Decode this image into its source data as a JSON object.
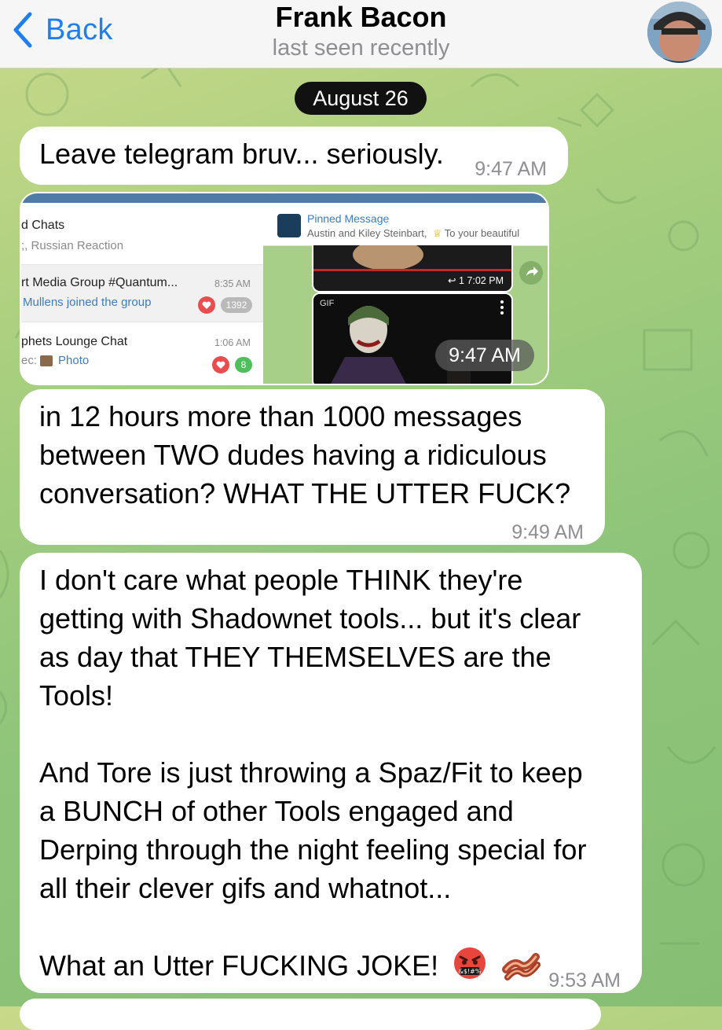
{
  "header": {
    "back_label": "Back",
    "title": "Frank Bacon",
    "status": "last seen recently"
  },
  "date_pill": "August 26",
  "messages": [
    {
      "text": "Leave telegram bruv... seriously.",
      "time": "9:47 AM"
    },
    {
      "type": "image",
      "time": "9:47 AM",
      "screenshot": {
        "list_header": {
          "name": "d Chats",
          "sub": ";, Russian Reaction"
        },
        "rows": [
          {
            "name": "rt Media Group #Quantum...",
            "time": "8:35 AM",
            "sub": "Mullens joined the group",
            "count": "1392"
          },
          {
            "name": "phets Lounge Chat",
            "time": "1:06 AM",
            "sub_prefix": "ec:",
            "sub": "Photo",
            "count": "8"
          }
        ],
        "pinned": {
          "title": "Pinned Message",
          "sub": "Austin and Kiley Steinbart,",
          "sub2": "To your beautiful"
        },
        "video_meta": "↩ 1  7:02 PM",
        "gif_label": "GIF"
      }
    },
    {
      "lines": [
        "in 12 hours more than 1000 messages",
        "between TWO dudes having a ridiculous",
        "conversation?  WHAT THE UTTER FUCK?"
      ],
      "time": "9:49 AM"
    },
    {
      "para1": [
        "I don't care what people THINK they're",
        "getting with Shadownet tools... but it's clear",
        "as day that THEY THEMSELVES are the",
        "Tools!"
      ],
      "para2": [
        "And Tore is just throwing a Spaz/Fit to keep",
        "a BUNCH of other Tools engaged and",
        "Derping through the night feeling special for",
        "all their clever gifs and whatnot..."
      ],
      "para3": "What an Utter FUCKING JOKE!",
      "emojis": [
        "angry-cursing-face-icon",
        "bacon-icon"
      ],
      "time": "9:53 AM"
    }
  ],
  "colors": {
    "accent": "#1f7ff0",
    "date_pill_bg": "#111111",
    "wallpaper": "#9ccb7c"
  }
}
